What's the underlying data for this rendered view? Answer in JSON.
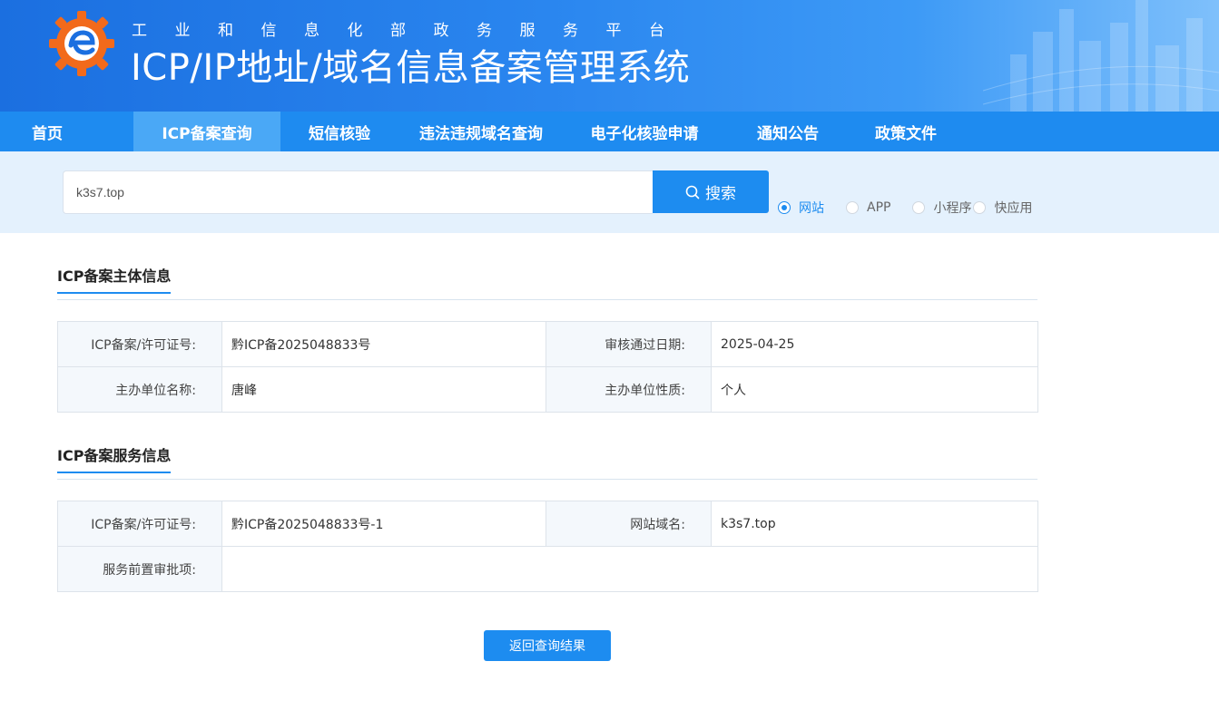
{
  "header": {
    "subtitle": "工业和信息化部政务服务平台",
    "title": "ICP/IP地址/域名信息备案管理系统"
  },
  "nav": [
    {
      "label": "首页",
      "active": false
    },
    {
      "label": "ICP备案查询",
      "active": true
    },
    {
      "label": "短信核验",
      "active": false
    },
    {
      "label": "违法违规域名查询",
      "active": false
    },
    {
      "label": "电子化核验申请",
      "active": false
    },
    {
      "label": "通知公告",
      "active": false
    },
    {
      "label": "政策文件",
      "active": false
    }
  ],
  "search": {
    "value": "k3s7.top",
    "button_label": "搜索",
    "options": [
      {
        "label": "网站",
        "checked": true
      },
      {
        "label": "APP",
        "checked": false
      },
      {
        "label": "小程序",
        "checked": false
      },
      {
        "label": "快应用",
        "checked": false
      }
    ]
  },
  "subject": {
    "title": "ICP备案主体信息",
    "license_label": "ICP备案/许可证号:",
    "license_value": "黔ICP备2025048833号",
    "date_label": "审核通过日期:",
    "date_value": "2025-04-25",
    "org_label": "主办单位名称:",
    "org_value": "唐峰",
    "nature_label": "主办单位性质:",
    "nature_value": "个人"
  },
  "service": {
    "title": "ICP备案服务信息",
    "license_label": "ICP备案/许可证号:",
    "license_value": "黔ICP备2025048833号-1",
    "domain_label": "网站域名:",
    "domain_value": "k3s7.top",
    "approval_label": "服务前置审批项:",
    "approval_value": ""
  },
  "back_button": "返回查询结果",
  "colors": {
    "primary": "#1d8cf0",
    "nav_bg": "#1e8bf0",
    "nav_active": "#4aa8f6",
    "search_bg": "#e4f1fd"
  }
}
